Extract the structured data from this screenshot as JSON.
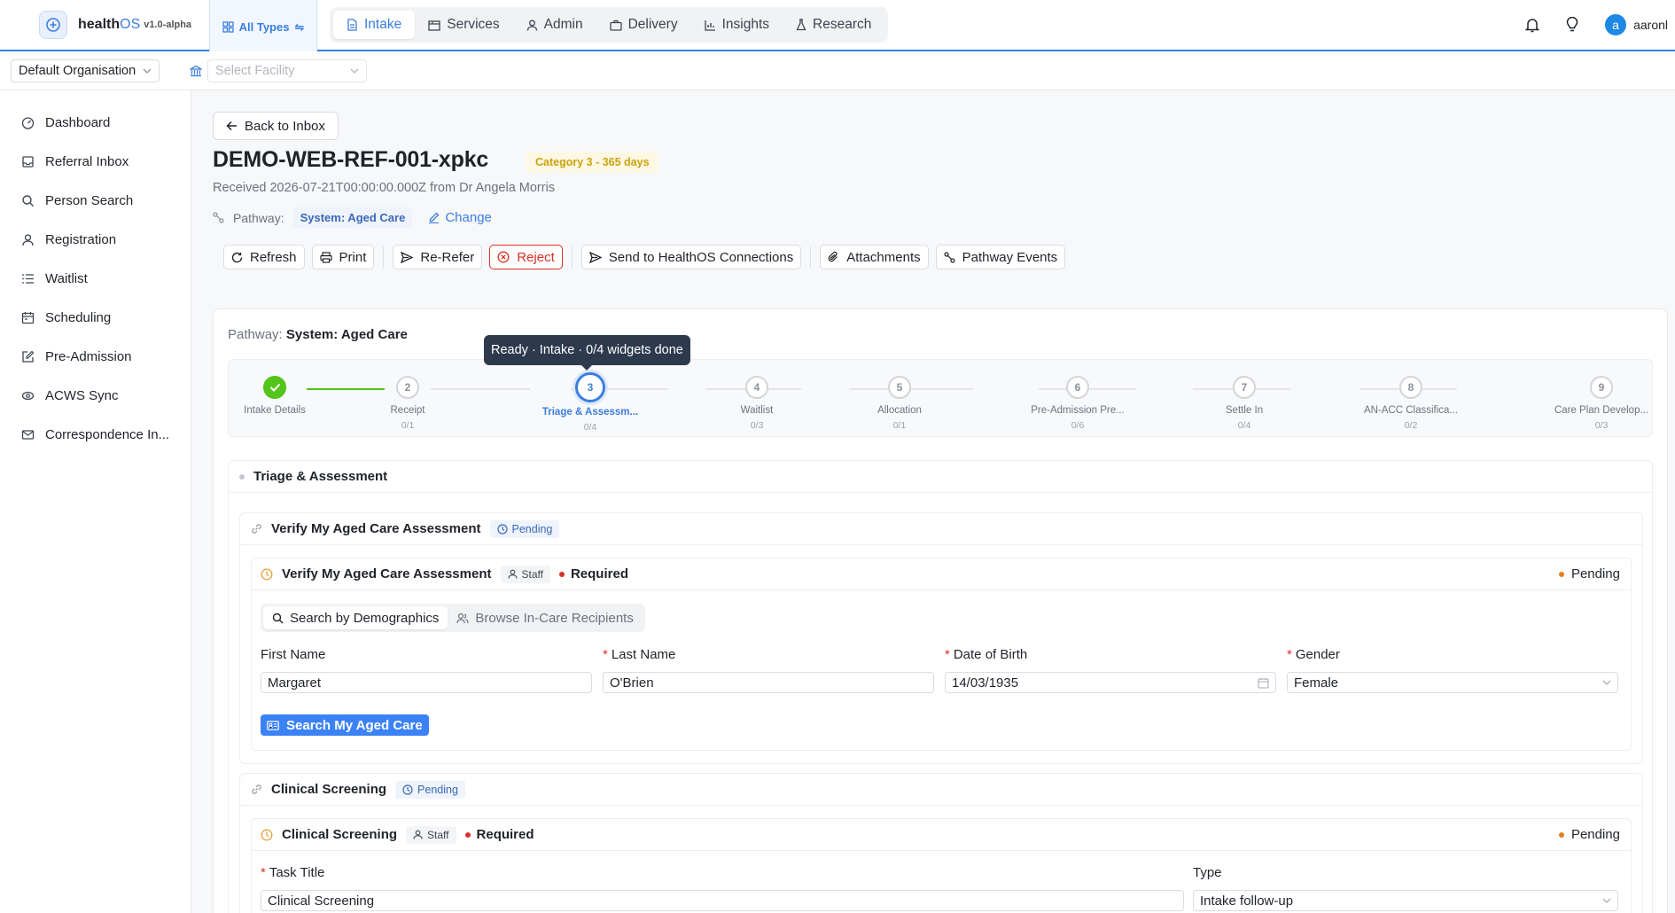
{
  "header": {
    "brand_main": "health",
    "brand_os": "OS",
    "version": "v1.0-alpha",
    "types_label": "All Types",
    "nav": [
      {
        "label": "Intake",
        "icon": "document-icon",
        "active": true
      },
      {
        "label": "Services",
        "icon": "box-icon",
        "active": false
      },
      {
        "label": "Admin",
        "icon": "user-admin-icon",
        "active": false
      },
      {
        "label": "Delivery",
        "icon": "briefcase-icon",
        "active": false
      },
      {
        "label": "Insights",
        "icon": "bar-chart-icon",
        "active": false
      },
      {
        "label": "Research",
        "icon": "flask-icon",
        "active": false
      }
    ],
    "user_initial": "a",
    "user_name": "aaronl"
  },
  "subbar": {
    "organisation": "Default Organisation",
    "facility_placeholder": "Select Facility"
  },
  "sidebar": {
    "items": [
      {
        "label": "Dashboard",
        "icon": "dashboard-icon"
      },
      {
        "label": "Referral Inbox",
        "icon": "inbox-icon"
      },
      {
        "label": "Person Search",
        "icon": "search-icon"
      },
      {
        "label": "Registration",
        "icon": "person-icon"
      },
      {
        "label": "Waitlist",
        "icon": "list-icon"
      },
      {
        "label": "Scheduling",
        "icon": "calendar-icon"
      },
      {
        "label": "Pre-Admission",
        "icon": "edit-icon"
      },
      {
        "label": "ACWS Sync",
        "icon": "sync-icon"
      },
      {
        "label": "Correspondence In...",
        "icon": "mail-icon"
      }
    ]
  },
  "referral": {
    "back_label": "Back to Inbox",
    "title": "DEMO-WEB-REF-001-xpkc",
    "category": "Category 3 - 365 days",
    "received": "Received 2026-07-21T00:00:00.000Z from Dr Angela Morris",
    "pathway_label": "Pathway:",
    "pathway_value": "System: Aged Care",
    "change_label": "Change"
  },
  "actions": {
    "refresh": "Refresh",
    "print": "Print",
    "rerefer": "Re-Refer",
    "reject": "Reject",
    "send": "Send to HealthOS Connections",
    "attachments": "Attachments",
    "events": "Pathway Events"
  },
  "card": {
    "pathway_label": "Pathway:",
    "pathway_value": "System: Aged Care",
    "tooltip": "Ready · Intake · 0/4 widgets done"
  },
  "steps": [
    {
      "num": "1",
      "label": "Intake Details",
      "count": "",
      "state": "done"
    },
    {
      "num": "2",
      "label": "Receipt",
      "count": "0/1",
      "state": "todo"
    },
    {
      "num": "3",
      "label": "Triage & Assessm...",
      "count": "0/4",
      "state": "current"
    },
    {
      "num": "4",
      "label": "Waitlist",
      "count": "0/3",
      "state": "todo"
    },
    {
      "num": "5",
      "label": "Allocation",
      "count": "0/1",
      "state": "todo"
    },
    {
      "num": "6",
      "label": "Pre-Admission Pre...",
      "count": "0/6",
      "state": "todo"
    },
    {
      "num": "7",
      "label": "Settle In",
      "count": "0/4",
      "state": "todo"
    },
    {
      "num": "8",
      "label": "AN-ACC Classifica...",
      "count": "0/2",
      "state": "todo"
    },
    {
      "num": "9",
      "label": "Care Plan Develop...",
      "count": "0/3",
      "state": "todo"
    }
  ],
  "section": {
    "title": "Triage & Assessment"
  },
  "widget1": {
    "title": "Verify My Aged Care Assessment",
    "status": "Pending",
    "task_title": "Verify My Aged Care Assessment",
    "staff": "Staff",
    "required": "Required",
    "task_status": "Pending",
    "tab_search": "Search by Demographics",
    "tab_browse": "Browse In-Care Recipients",
    "first_name_label": "First Name",
    "first_name_value": "Margaret",
    "last_name_label": "Last Name",
    "last_name_value": "O'Brien",
    "dob_label": "Date of Birth",
    "dob_value": "14/03/1935",
    "gender_label": "Gender",
    "gender_value": "Female",
    "search_button": "Search My Aged Care"
  },
  "widget2": {
    "title": "Clinical Screening",
    "status": "Pending",
    "task_title": "Clinical Screening",
    "staff": "Staff",
    "required": "Required",
    "task_status": "Pending",
    "task_title_label": "Task Title",
    "task_title_value": "Clinical Screening",
    "type_label": "Type",
    "type_value": "Intake follow-up"
  },
  "colors": {
    "accent": "#3b7ddd",
    "success": "#52c41a",
    "danger": "#d93025",
    "warning": "#caa30c"
  }
}
